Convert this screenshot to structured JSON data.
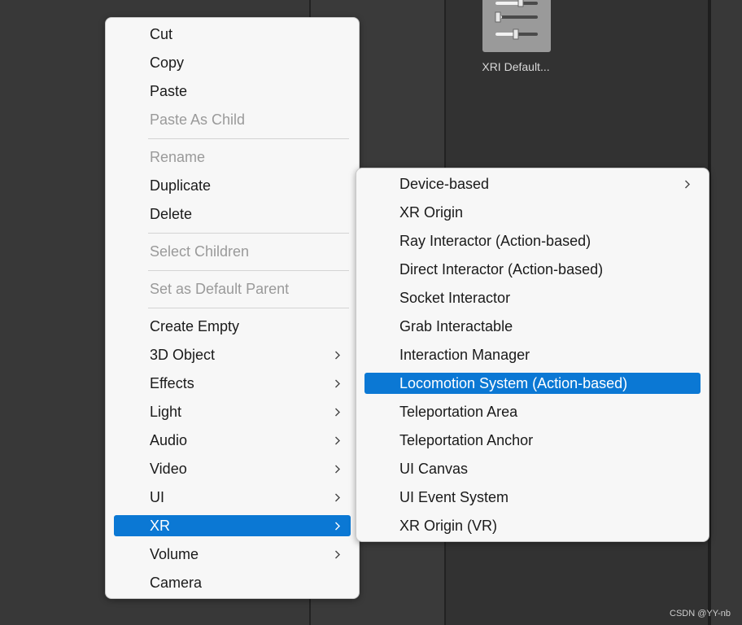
{
  "background_asset": {
    "label": "XRI Default...",
    "icon": "slider-settings-icon"
  },
  "watermark": "CSDN @YY-nb",
  "context_menu": {
    "items": [
      {
        "label": "Cut",
        "enabled": true
      },
      {
        "label": "Copy",
        "enabled": true
      },
      {
        "label": "Paste",
        "enabled": true
      },
      {
        "label": "Paste As Child",
        "enabled": false
      },
      {
        "label": "Rename",
        "enabled": false
      },
      {
        "label": "Duplicate",
        "enabled": true
      },
      {
        "label": "Delete",
        "enabled": true
      },
      {
        "label": "Select Children",
        "enabled": false
      },
      {
        "label": "Set as Default Parent",
        "enabled": false
      },
      {
        "label": "Create Empty",
        "enabled": true
      },
      {
        "label": "3D Object",
        "enabled": true,
        "submenu": true
      },
      {
        "label": "Effects",
        "enabled": true,
        "submenu": true
      },
      {
        "label": "Light",
        "enabled": true,
        "submenu": true
      },
      {
        "label": "Audio",
        "enabled": true,
        "submenu": true
      },
      {
        "label": "Video",
        "enabled": true,
        "submenu": true
      },
      {
        "label": "UI",
        "enabled": true,
        "submenu": true
      },
      {
        "label": "XR",
        "enabled": true,
        "submenu": true,
        "highlighted": true
      },
      {
        "label": "Volume",
        "enabled": true,
        "submenu": true
      },
      {
        "label": "Camera",
        "enabled": true
      }
    ]
  },
  "xr_submenu": {
    "items": [
      {
        "label": "Device-based",
        "submenu": true
      },
      {
        "label": "XR Origin"
      },
      {
        "label": "Ray Interactor (Action-based)"
      },
      {
        "label": "Direct Interactor (Action-based)"
      },
      {
        "label": "Socket Interactor"
      },
      {
        "label": "Grab Interactable"
      },
      {
        "label": "Interaction Manager"
      },
      {
        "label": "Locomotion System (Action-based)",
        "highlighted": true
      },
      {
        "label": "Teleportation Area"
      },
      {
        "label": "Teleportation Anchor"
      },
      {
        "label": "UI Canvas"
      },
      {
        "label": "UI Event System"
      },
      {
        "label": "XR Origin (VR)"
      }
    ]
  },
  "colors": {
    "highlight": "#0b78d4",
    "menu_bg": "#f7f7f7",
    "disabled_text": "#9a9a9a",
    "editor_bg": "#383838"
  }
}
